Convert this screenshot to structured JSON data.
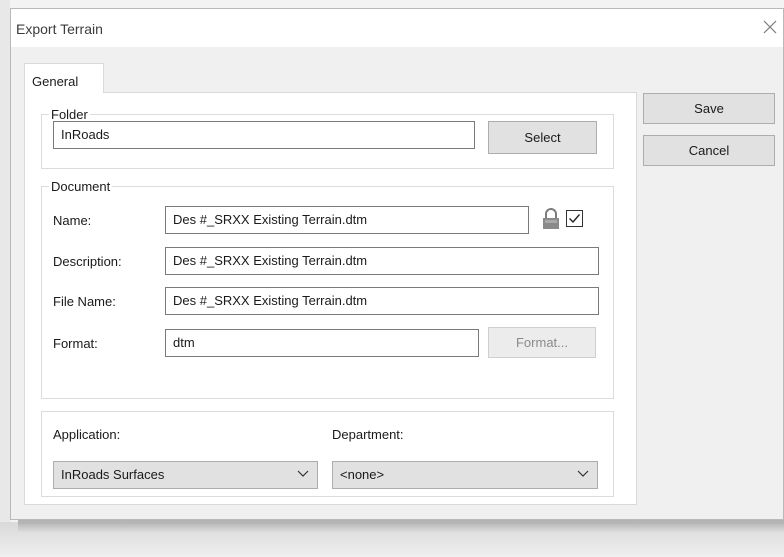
{
  "window": {
    "title": "Export Terrain"
  },
  "tabs": [
    {
      "label": "General",
      "active": true
    }
  ],
  "folder": {
    "legend": "Folder",
    "value": "InRoads",
    "select_label": "Select"
  },
  "document": {
    "legend": "Document",
    "name_label": "Name:",
    "name_value": "Des #_SRXX Existing Terrain.dtm",
    "name_locked_checkbox": true,
    "description_label": "Description:",
    "description_value": "Des #_SRXX Existing Terrain.dtm",
    "filename_label": "File Name:",
    "filename_value": "Des #_SRXX Existing Terrain.dtm",
    "format_label": "Format:",
    "format_value": "dtm",
    "format_button_label": "Format..."
  },
  "application": {
    "label": "Application:",
    "selected": "InRoads Surfaces"
  },
  "department": {
    "label": "Department:",
    "selected": "<none>"
  },
  "actions": {
    "save_label": "Save",
    "cancel_label": "Cancel"
  },
  "icons": {
    "close": "close-icon",
    "lock": "lock-icon",
    "chevron": "chevron-down-icon"
  },
  "colors": {
    "dialog_bg": "#f0f0f0",
    "button_bg": "#e1e1e1",
    "border": "#adadad"
  }
}
